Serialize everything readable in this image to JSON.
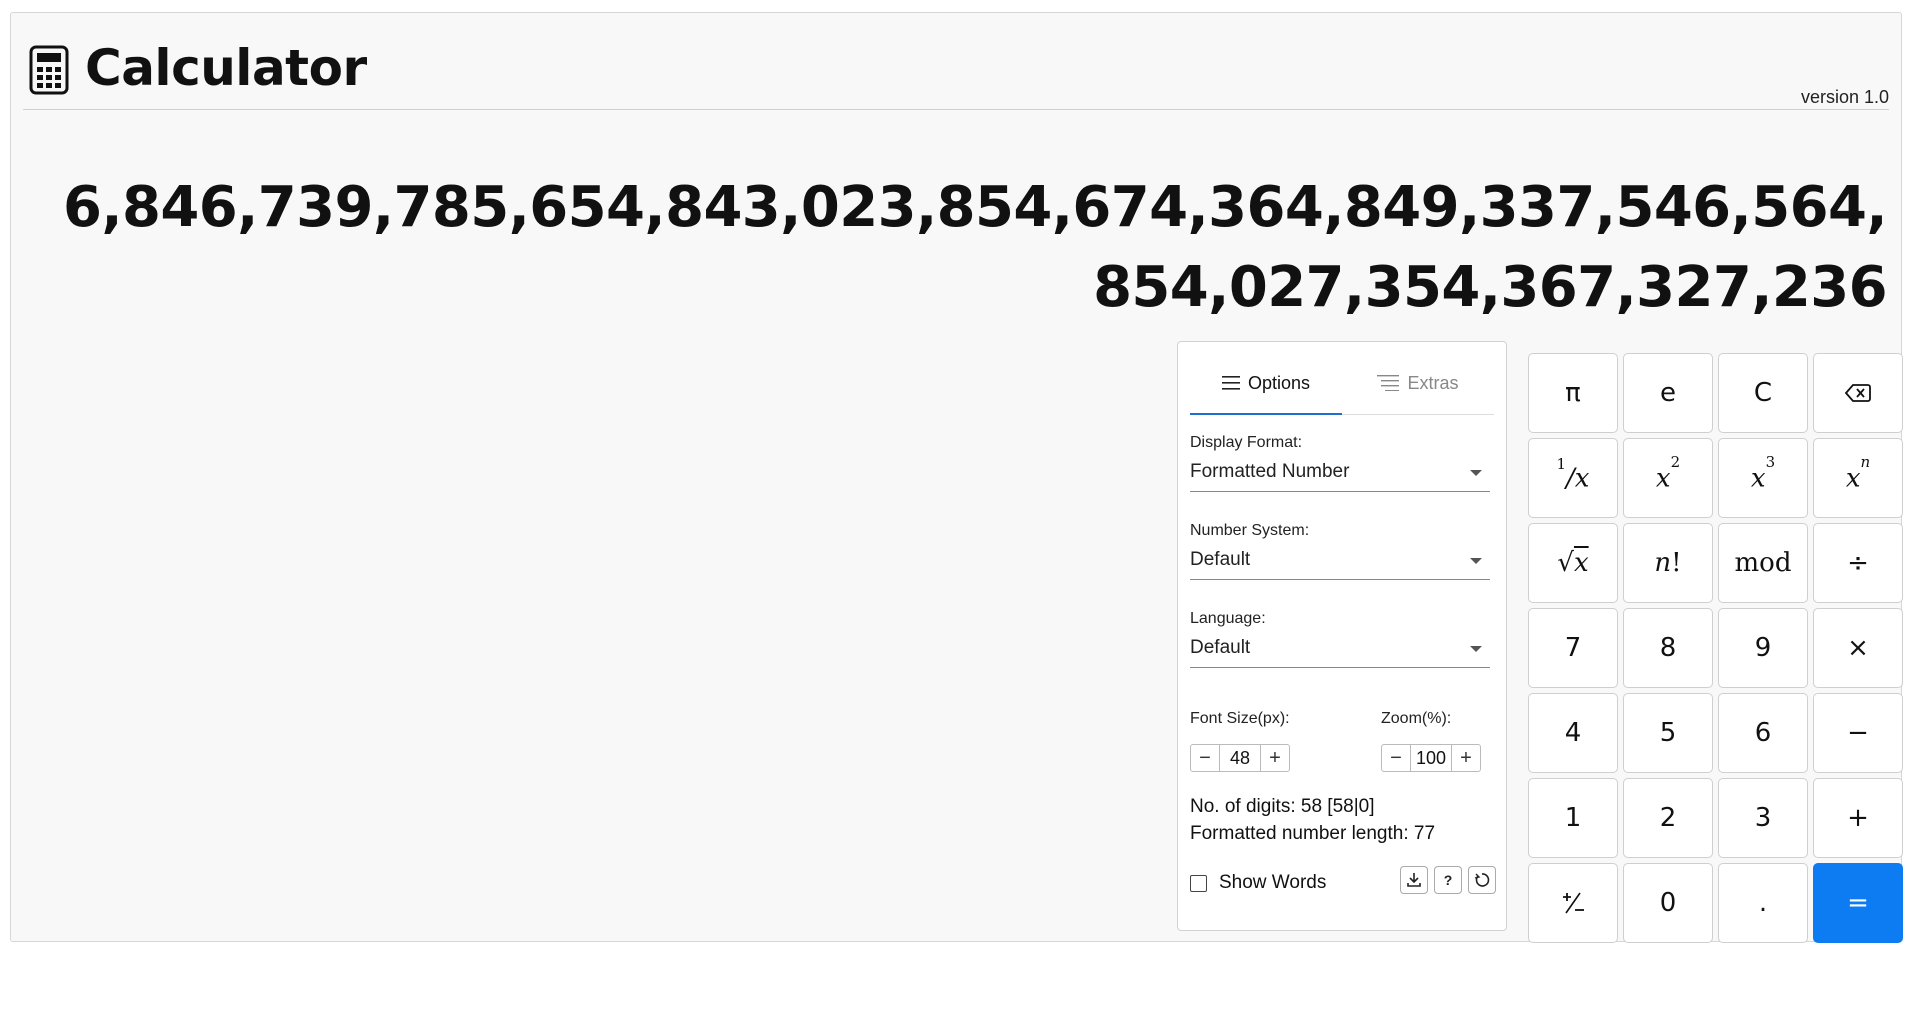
{
  "header": {
    "title": "Calculator",
    "version": "version 1.0"
  },
  "display": {
    "value": "6,846,739,785,654,843,023,854,674,364,849,337,546,564,854,027,354,367,327,236"
  },
  "panel": {
    "tabs": [
      {
        "label": "Options",
        "active": true
      },
      {
        "label": "Extras",
        "active": false
      }
    ],
    "display_format": {
      "label": "Display Format:",
      "value": "Formatted Number"
    },
    "number_system": {
      "label": "Number System:",
      "value": "Default"
    },
    "language": {
      "label": "Language:",
      "value": "Default"
    },
    "font_size": {
      "label": "Font Size(px):",
      "value": "48"
    },
    "zoom": {
      "label": "Zoom(%):",
      "value": "100"
    },
    "digits": "No. of digits: 58 [58|0]",
    "formatted_length": "Formatted number length: 77",
    "show_words": {
      "label": "Show Words",
      "checked": false
    },
    "help_label": "?"
  },
  "keypad": {
    "pi": "π",
    "e": "e",
    "clear": "C",
    "mod": "mod",
    "divide": "÷",
    "seven": "7",
    "eight": "8",
    "nine": "9",
    "multiply": "×",
    "four": "4",
    "five": "5",
    "six": "6",
    "minus": "−",
    "one": "1",
    "two": "2",
    "three": "3",
    "plus": "+",
    "zero": "0",
    "decimal": ".",
    "equals": "="
  },
  "colors": {
    "accent": "#0d7bf2",
    "tab_underline": "#1e6fd0",
    "background": "#f8f8f8"
  }
}
